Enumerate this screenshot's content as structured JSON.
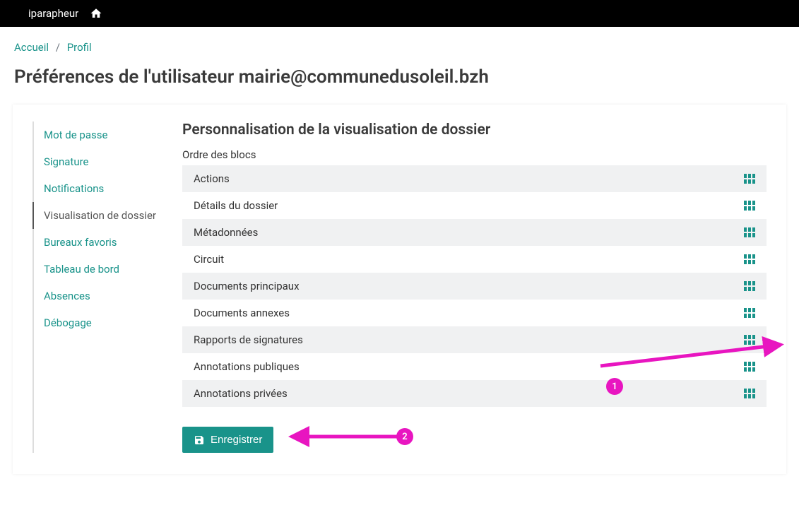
{
  "topbar": {
    "brand": "iparapheur"
  },
  "breadcrumb": {
    "home": "Accueil",
    "profile": "Profil"
  },
  "page_title": "Préférences de l'utilisateur mairie@communedusoleil.bzh",
  "sidebar": {
    "items": [
      {
        "label": "Mot de passe",
        "active": false
      },
      {
        "label": "Signature",
        "active": false
      },
      {
        "label": "Notifications",
        "active": false
      },
      {
        "label": "Visualisation de dossier",
        "active": true
      },
      {
        "label": "Bureaux favoris",
        "active": false
      },
      {
        "label": "Tableau de bord",
        "active": false
      },
      {
        "label": "Absences",
        "active": false
      },
      {
        "label": "Débogage",
        "active": false
      }
    ]
  },
  "main": {
    "section_title": "Personnalisation de la visualisation de dossier",
    "subsection_label": "Ordre des blocs",
    "blocks": [
      "Actions",
      "Détails du dossier",
      "Métadonnées",
      "Circuit",
      "Documents principaux",
      "Documents annexes",
      "Rapports de signatures",
      "Annotations publiques",
      "Annotations privées"
    ],
    "save_label": "Enregistrer"
  },
  "annotations": {
    "badge1": "1",
    "badge2": "2",
    "color": "#e815c0"
  }
}
